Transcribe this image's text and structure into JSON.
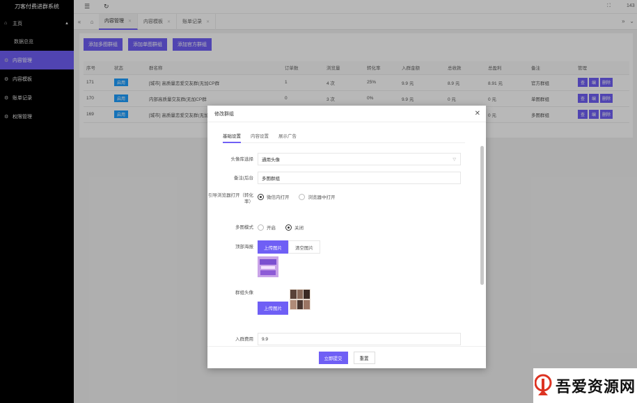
{
  "app": {
    "title": "刀客付费进群系统"
  },
  "sidebar": {
    "items": [
      {
        "label": "主页",
        "icon": "home-icon"
      },
      {
        "label": "数据总览"
      },
      {
        "label": "内容管理",
        "icon": "settings-icon"
      },
      {
        "label": "内容模板",
        "icon": "settings-icon"
      },
      {
        "label": "账单记录",
        "icon": "settings-icon"
      },
      {
        "label": "权限管理",
        "icon": "settings-icon"
      }
    ]
  },
  "topbar": {
    "right_text": "143"
  },
  "tabs": [
    {
      "label": "内容管理"
    },
    {
      "label": "内容模板"
    },
    {
      "label": "账单记录"
    }
  ],
  "toolbar": {
    "buttons": [
      "添加多图群组",
      "添加单图群组",
      "添加官方群组"
    ]
  },
  "table": {
    "headers": [
      "序号",
      "状态",
      "群名称",
      "订单数",
      "浏览量",
      "转化率",
      "入群金额",
      "总收款",
      "总盈利",
      "备注",
      "管理"
    ],
    "rows": [
      [
        "171",
        "启用",
        "[城市] 高质量恋爱交友群(无加CP群",
        "1",
        "4 次",
        "25%",
        "9.9 元",
        "8.9 元",
        "8.91 元",
        "官方群组"
      ],
      [
        "170",
        "启用",
        "内部高质量交友群(无加CP群",
        "0",
        "3 次",
        "0%",
        "9.9 元",
        "0 元",
        "0 元",
        "单图群组"
      ],
      [
        "169",
        "启用",
        "[城市] 高质量恋爱交友群(无加",
        "0",
        "",
        "",
        "",
        "",
        "0 元",
        "多图群组"
      ]
    ],
    "ops": [
      "查",
      "编",
      "删除"
    ]
  },
  "modal": {
    "title": "修改群组",
    "tabs": [
      "基础设置",
      "内容设置",
      "展示广告"
    ],
    "fields": {
      "avatar_lib": {
        "label": "头像库选择",
        "value": "通用头像"
      },
      "note": {
        "label": "备注(后台",
        "value": "多图群组"
      },
      "open_mode": {
        "label": "引导浏览器打开（转化率）",
        "options": [
          "微信内打开",
          "浏览器中打开"
        ]
      },
      "multi_mode": {
        "label": "多图模式",
        "options": [
          "开启",
          "关闭"
        ]
      },
      "top_banner": {
        "label": "顶部海报",
        "upload": "上传图片",
        "clear": "清空图片"
      },
      "group_avatar": {
        "label": "群组头像",
        "upload": "上传图片"
      },
      "fee": {
        "label": "入群费用",
        "value": "9.9"
      }
    },
    "submit": "立即提交",
    "reset": "重置"
  },
  "watermark": {
    "text": "吾爱资源网"
  }
}
